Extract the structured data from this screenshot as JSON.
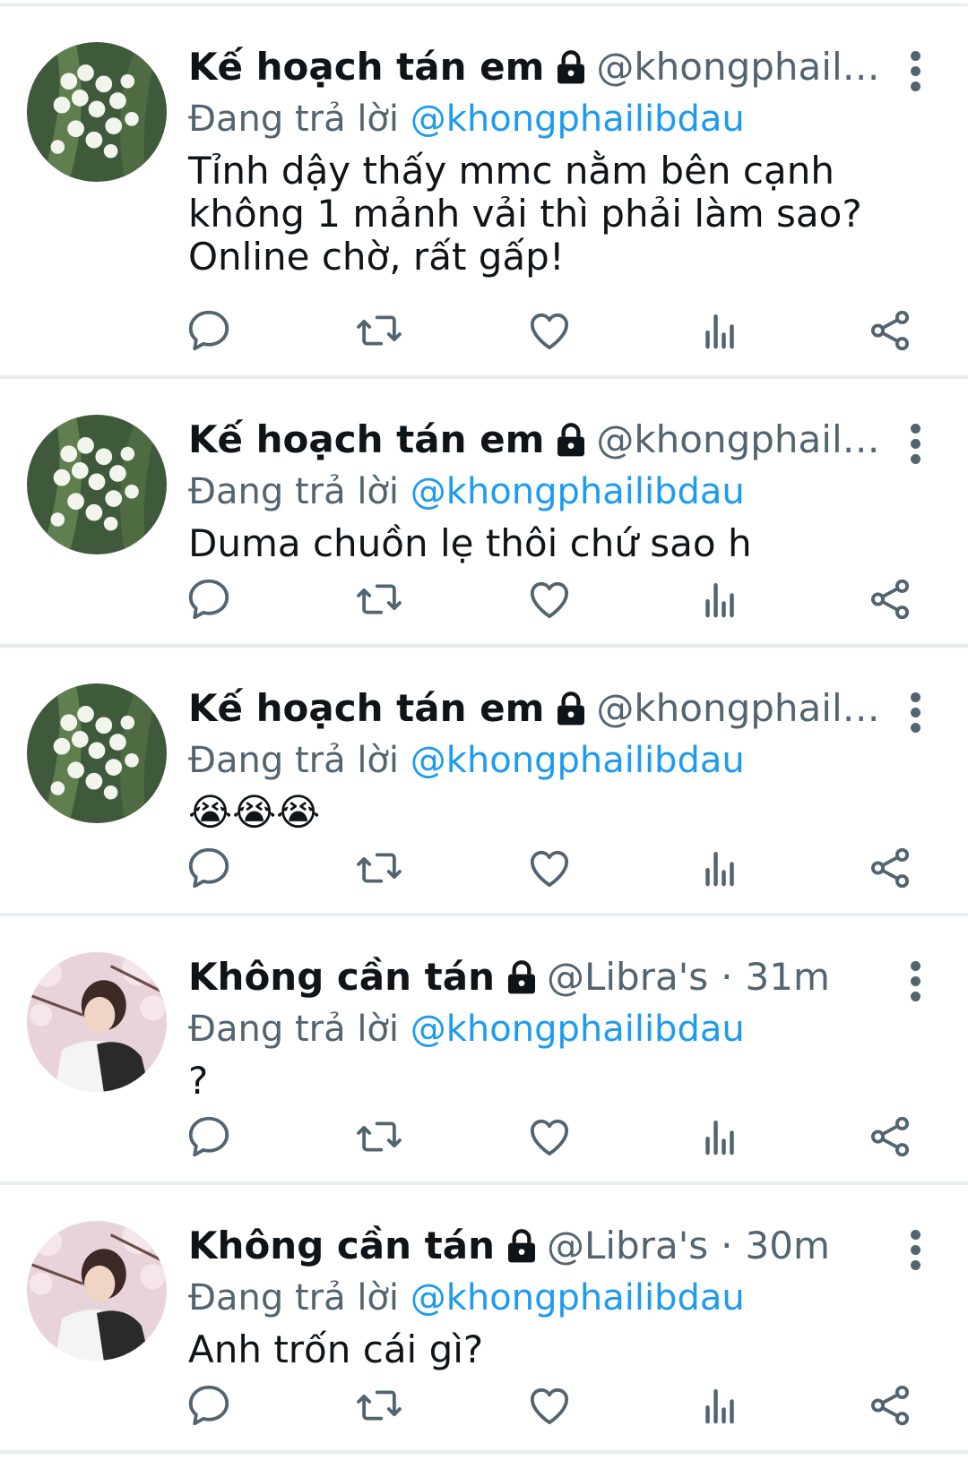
{
  "tweets": [
    {
      "name": "Kế hoạch tán em",
      "handle": "@khongphailibd···",
      "time": "",
      "replying_prefix": "Đang trả lời ",
      "replying_to": "@khongphailibdau",
      "text": "Tỉnh dậy thấy mmc nằm bên cạnh không 1 mảnh vải thì phải làm sao? Online chờ, rất gấp!",
      "avatar": "lily-of-the-valley-avatar"
    },
    {
      "name": "Kế hoạch tán em",
      "handle": "@khongphailibd···",
      "time": "",
      "replying_prefix": "Đang trả lời ",
      "replying_to": "@khongphailibdau",
      "text": "Duma chuồn lẹ thôi chứ sao h",
      "avatar": "lily-of-the-valley-avatar"
    },
    {
      "name": "Kế hoạch tán em",
      "handle": "@khongphailibd···",
      "time": "",
      "replying_prefix": "Đang trả lời ",
      "replying_to": "@khongphailibdau",
      "text": "😭😭😭",
      "avatar": "lily-of-the-valley-avatar"
    },
    {
      "name": "Không cần tán",
      "handle": "@Libra's",
      "time": "31m",
      "replying_prefix": "Đang trả lời ",
      "replying_to": "@khongphailibdau",
      "text": "?",
      "avatar": "boy-cherry-blossom-avatar"
    },
    {
      "name": "Không cần tán",
      "handle": "@Libra's",
      "time": "30m",
      "replying_prefix": "Đang trả lời ",
      "replying_to": "@khongphailibdau",
      "text": "Anh trốn cái gì?",
      "avatar": "boy-cherry-blossom-avatar"
    }
  ],
  "separator": "·",
  "icons": {
    "reply": "reply-icon",
    "retweet": "retweet-icon",
    "like": "like-icon",
    "views": "views-icon",
    "share": "share-icon",
    "more": "more-icon",
    "lock": "lock-icon"
  },
  "colors": {
    "text": "#0f1419",
    "secondary": "#536471",
    "accent": "#1d9bf0",
    "divider": "#e6ecf0"
  }
}
